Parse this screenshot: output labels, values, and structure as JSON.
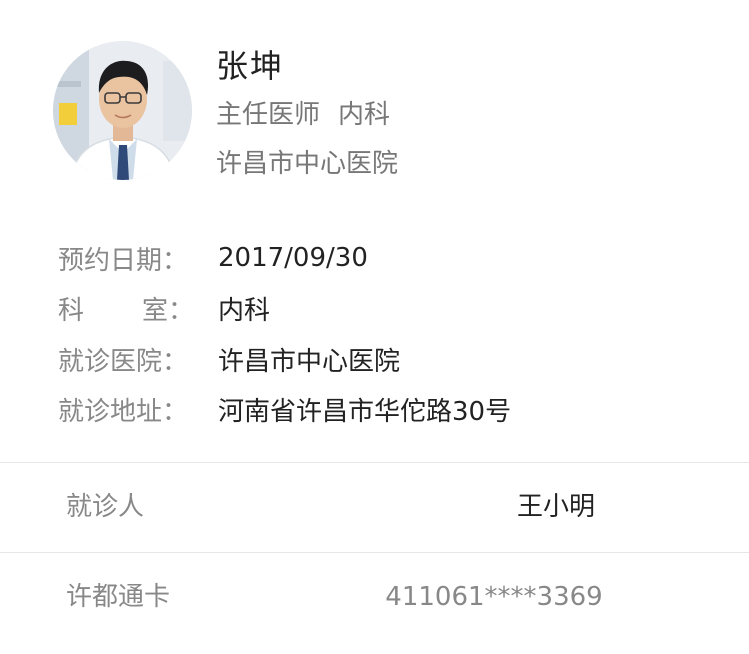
{
  "doctor": {
    "name": "张坤",
    "title": "主任医师",
    "department": "内科",
    "hospital": "许昌市中心医院",
    "avatar_icon": "doctor-portrait-icon"
  },
  "appointment": {
    "rows": [
      {
        "label": "预约日期：",
        "value": "2017/09/30"
      },
      {
        "label_left": "科",
        "label_right": "室：",
        "value": "内科"
      },
      {
        "label": "就诊医院：",
        "value": "许昌市中心医院"
      },
      {
        "label": "就诊地址：",
        "value": "河南省许昌市华佗路30号"
      }
    ]
  },
  "patient": {
    "label": "就诊人",
    "value": "王小明"
  },
  "card": {
    "label": "许都通卡",
    "value": "411061****3369"
  },
  "colors": {
    "text_dark": "#222222",
    "text_gray": "#888888",
    "subtitle_gray": "#777777",
    "divider": "#e6e6e6",
    "background": "#ffffff"
  }
}
